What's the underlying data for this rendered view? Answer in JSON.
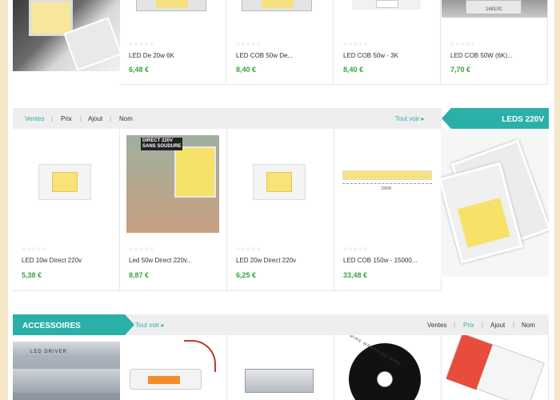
{
  "section1": {
    "products": [
      {
        "name": "LED De 20w 6K",
        "price": "6,48 €",
        "stars": "☆☆☆☆☆"
      },
      {
        "name": "LED COB 50w De...",
        "price": "8,40 €",
        "stars": "☆☆☆☆☆"
      },
      {
        "name": "LED COB 50w - 3K",
        "price": "8,40 €",
        "stars": "☆☆☆☆☆"
      },
      {
        "name": "LED COB 50W (6K)...",
        "price": "7,70 €",
        "stars": "☆☆☆☆☆"
      }
    ],
    "chip_label": "14810C"
  },
  "section2": {
    "tabs": [
      "Ventes",
      "Prix",
      "Ajout",
      "Nom"
    ],
    "active_tab": "Ventes",
    "view_all": "Tout voir ▸",
    "category": "LEDS 220V",
    "products": [
      {
        "name": "LED 10w Direct 220v",
        "price": "5,38 €",
        "stars": "☆☆☆☆☆"
      },
      {
        "name": "Led 50w Direct 220v...",
        "price": "8,87 €",
        "stars": "☆☆☆☆☆",
        "image_text": "DIRECT 220V\nSANS SOUDURE"
      },
      {
        "name": "LED 20w Direct 220v",
        "price": "6,25 €",
        "stars": "☆☆☆☆☆"
      },
      {
        "name": "LED COB 150w - 15000...",
        "price": "33,48 €",
        "stars": "☆☆☆☆☆",
        "image_text": "150W"
      }
    ]
  },
  "section3": {
    "category": "ACCESSOIRES",
    "view_all": "Tout voir ▸",
    "tabs": [
      "Ventes",
      "Prix",
      "Ajout",
      "Nom"
    ],
    "active_tab": "Prix",
    "image_texts": [
      "LED DRIVER",
      "WIRE WRAPPING WIRE"
    ]
  },
  "colors": {
    "accent": "#2ab0a8",
    "price": "#3aa33a",
    "background": "#f5e6c8"
  }
}
